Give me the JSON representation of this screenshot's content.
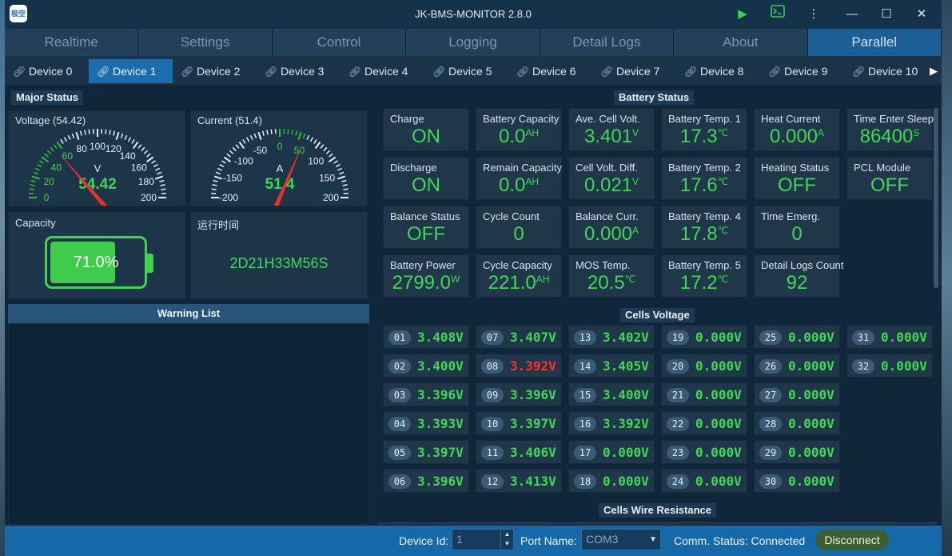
{
  "window": {
    "title": "JK-BMS-MONITOR 2.8.0",
    "app_icon": "极空"
  },
  "main_tabs": [
    "Realtime",
    "Settings",
    "Control",
    "Logging",
    "Detail Logs",
    "About",
    "Parallel"
  ],
  "active_main_tab": "Parallel",
  "device_tabs": [
    "Device 0",
    "Device 1",
    "Device 2",
    "Device 3",
    "Device 4",
    "Device 5",
    "Device 6",
    "Device 7",
    "Device 8",
    "Device 9",
    "Device 10"
  ],
  "active_device_tab": "Device 1",
  "major_status": {
    "title": "Major Status",
    "voltage": {
      "label": "Voltage (54.42)",
      "value": "54.42",
      "unit": "V",
      "ticks": [
        "0",
        "20",
        "40",
        "60",
        "80",
        "100",
        "120",
        "140",
        "160",
        "180",
        "200"
      ],
      "min": 0,
      "max": 200,
      "reading": 54.42
    },
    "current": {
      "label": "Current (51.4)",
      "value": "51.4",
      "unit": "A",
      "ticks": [
        "-200",
        "-150",
        "-100",
        "-50",
        "0",
        "50",
        "100",
        "150",
        "200"
      ],
      "min": -200,
      "max": 200,
      "reading": 51.4
    },
    "capacity": {
      "label": "Capacity",
      "percent_text": "71.0%",
      "fraction": 0.71
    },
    "runtime": {
      "label": "运行时间",
      "value": "2D21H33M56S"
    }
  },
  "warning_list": {
    "title": "Warning List",
    "items": []
  },
  "battery_status": {
    "title": "Battery Status",
    "cards": [
      {
        "label": "Charge",
        "value": "ON",
        "unit": ""
      },
      {
        "label": "Battery Capacity",
        "value": "0.0",
        "unit": "AH"
      },
      {
        "label": "Ave. Cell Volt.",
        "value": "3.401",
        "unit": "V"
      },
      {
        "label": "Battery Temp. 1",
        "value": "17.3",
        "unit": "℃"
      },
      {
        "label": "Heat Current",
        "value": "0.000",
        "unit": "A"
      },
      {
        "label": "Time Enter Sleep",
        "value": "86400",
        "unit": "S"
      },
      {
        "label": "Discharge",
        "value": "ON",
        "unit": ""
      },
      {
        "label": "Remain Capacity",
        "value": "0.0",
        "unit": "AH"
      },
      {
        "label": "Cell Volt. Diff.",
        "value": "0.021",
        "unit": "V"
      },
      {
        "label": "Battery Temp. 2",
        "value": "17.6",
        "unit": "℃"
      },
      {
        "label": "Heating Status",
        "value": "OFF",
        "unit": ""
      },
      {
        "label": "PCL Module",
        "value": "OFF",
        "unit": ""
      },
      {
        "label": "Balance Status",
        "value": "OFF",
        "unit": ""
      },
      {
        "label": "Cycle Count",
        "value": "0",
        "unit": ""
      },
      {
        "label": "Balance Curr.",
        "value": "0.000",
        "unit": "A"
      },
      {
        "label": "Battery Temp. 4",
        "value": "17.8",
        "unit": "℃"
      },
      {
        "label": "Time Emerg.",
        "value": "0",
        "unit": ""
      },
      {
        "label": "Battery Power",
        "value": "2799.0",
        "unit": "W"
      },
      {
        "label": "Cycle Capacity",
        "value": "221.0",
        "unit": "AH"
      },
      {
        "label": "MOS Temp.",
        "value": "20.5",
        "unit": "℃"
      },
      {
        "label": "Battery Temp. 5",
        "value": "17.2",
        "unit": "℃"
      },
      {
        "label": "Detail Logs Count",
        "value": "92",
        "unit": ""
      }
    ]
  },
  "cells_voltage": {
    "title": "Cells Voltage",
    "cells": [
      {
        "n": "01",
        "v": "3.408"
      },
      {
        "n": "02",
        "v": "3.400"
      },
      {
        "n": "03",
        "v": "3.396"
      },
      {
        "n": "04",
        "v": "3.393"
      },
      {
        "n": "05",
        "v": "3.397"
      },
      {
        "n": "06",
        "v": "3.396"
      },
      {
        "n": "07",
        "v": "3.407"
      },
      {
        "n": "08",
        "v": "3.392",
        "alert": true
      },
      {
        "n": "09",
        "v": "3.396"
      },
      {
        "n": "10",
        "v": "3.397"
      },
      {
        "n": "11",
        "v": "3.406"
      },
      {
        "n": "12",
        "v": "3.413"
      },
      {
        "n": "13",
        "v": "3.402"
      },
      {
        "n": "14",
        "v": "3.405"
      },
      {
        "n": "15",
        "v": "3.400"
      },
      {
        "n": "16",
        "v": "3.392"
      },
      {
        "n": "17",
        "v": "0.000"
      },
      {
        "n": "18",
        "v": "0.000"
      },
      {
        "n": "19",
        "v": "0.000"
      },
      {
        "n": "20",
        "v": "0.000"
      },
      {
        "n": "21",
        "v": "0.000"
      },
      {
        "n": "22",
        "v": "0.000"
      },
      {
        "n": "23",
        "v": "0.000"
      },
      {
        "n": "24",
        "v": "0.000"
      },
      {
        "n": "25",
        "v": "0.000"
      },
      {
        "n": "26",
        "v": "0.000"
      },
      {
        "n": "27",
        "v": "0.000"
      },
      {
        "n": "28",
        "v": "0.000"
      },
      {
        "n": "29",
        "v": "0.000"
      },
      {
        "n": "30",
        "v": "0.000"
      },
      {
        "n": "31",
        "v": "0.000"
      },
      {
        "n": "32",
        "v": "0.000"
      }
    ],
    "cell_unit": "V"
  },
  "cells_wire_resistance": {
    "title": "Cells Wire Resistance"
  },
  "statusbar": {
    "device_id_label": "Device Id:",
    "device_id_value": "1",
    "port_label": "Port Name:",
    "port_value": "COM3",
    "comm_status": "Comm. Status: Connected",
    "disconnect_label": "Disconnect"
  },
  "colors": {
    "accent": "#1c6dad",
    "value_green": "#43d657",
    "alert_red": "#ff3131",
    "gauge_needle": "#e8322a"
  }
}
